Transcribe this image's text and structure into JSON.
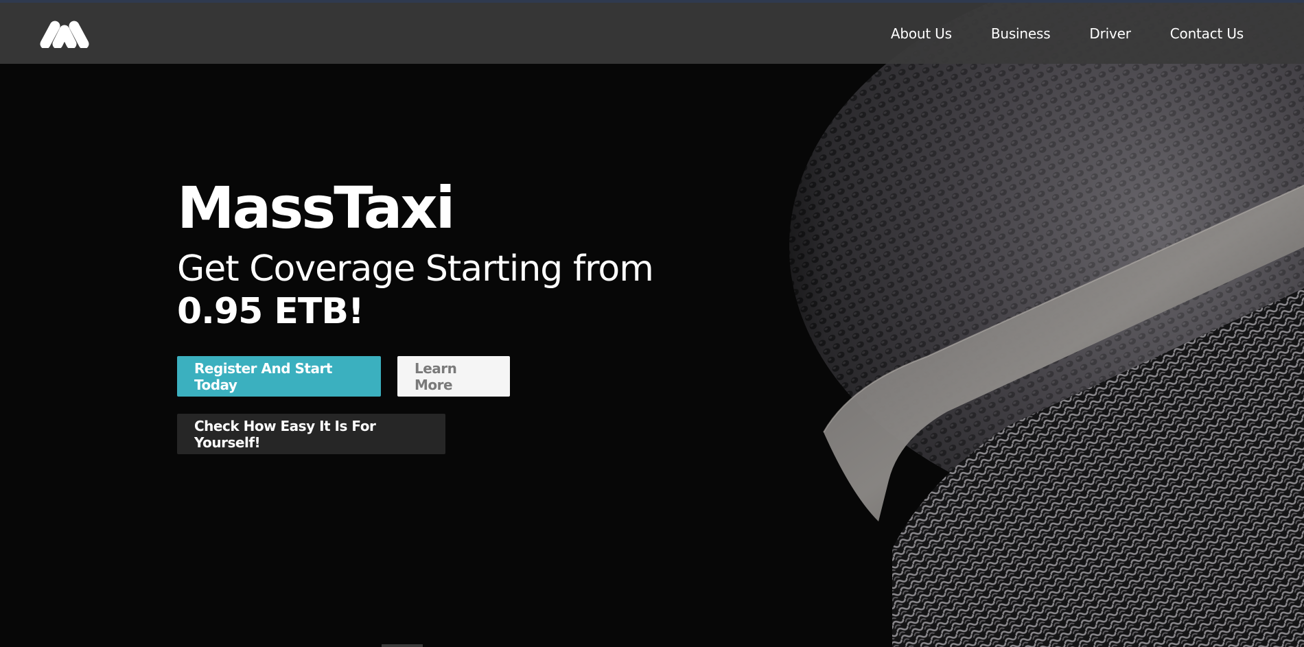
{
  "brand_name": "MassTaxi",
  "nav": {
    "logo_icon": "masstaxi-logo-icon",
    "links": [
      {
        "label": "About Us"
      },
      {
        "label": "Business"
      },
      {
        "label": "Driver"
      },
      {
        "label": "Contact Us"
      }
    ]
  },
  "hero": {
    "title": "MassTaxi",
    "tagline": "Get Coverage Starting from",
    "price": "0.95 ETB!",
    "primary_button": "Register And Start Today",
    "secondary_button": "Learn More",
    "dark_button": "Check How Easy It Is For Yourself!",
    "image_icon": "microphone-grille-photo"
  },
  "colors": {
    "accent": "#3bb0bf",
    "nav_bg": "#3a3a3a",
    "page_bg": "#070707",
    "dark_button": "#262626"
  }
}
